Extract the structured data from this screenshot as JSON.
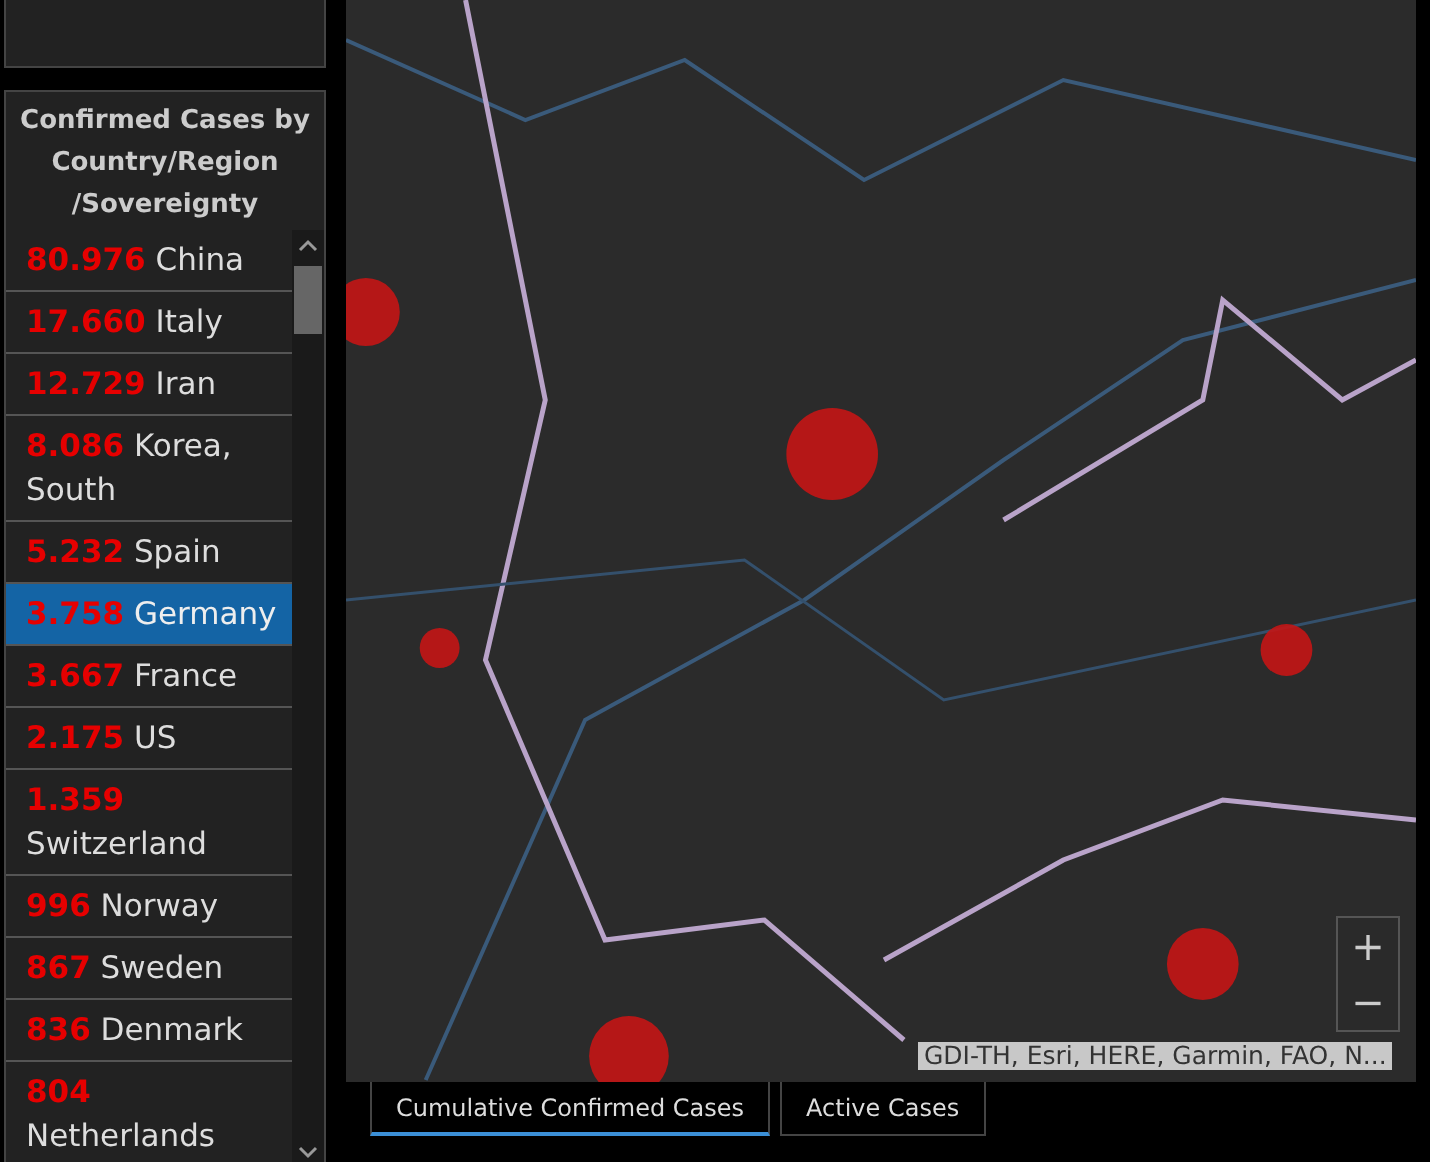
{
  "list_panel": {
    "title": "Confirmed Cases by Country/Region /Sovereignty",
    "items": [
      {
        "count": "80.976",
        "name": "China",
        "selected": false
      },
      {
        "count": "17.660",
        "name": "Italy",
        "selected": false
      },
      {
        "count": "12.729",
        "name": "Iran",
        "selected": false
      },
      {
        "count": "8.086",
        "name": "Korea, South",
        "selected": false
      },
      {
        "count": "5.232",
        "name": "Spain",
        "selected": false
      },
      {
        "count": "3.758",
        "name": "Germany",
        "selected": true
      },
      {
        "count": "3.667",
        "name": "France",
        "selected": false
      },
      {
        "count": "2.175",
        "name": "US",
        "selected": false
      },
      {
        "count": "1.359",
        "name": "Switzerland",
        "selected": false
      },
      {
        "count": "996",
        "name": "Norway",
        "selected": false
      },
      {
        "count": "867",
        "name": "Sweden",
        "selected": false
      },
      {
        "count": "836",
        "name": "Denmark",
        "selected": false
      },
      {
        "count": "804",
        "name": "Netherlands",
        "selected": false
      }
    ]
  },
  "map": {
    "zoom_in": "+",
    "zoom_out": "−",
    "attribution": "GDI-TH, Esri, HERE, Garmin, FAO, N..."
  },
  "tabs": [
    {
      "label": "Cumulative Confirmed Cases",
      "selected": true
    },
    {
      "label": "Active Cases",
      "selected": false
    }
  ]
}
